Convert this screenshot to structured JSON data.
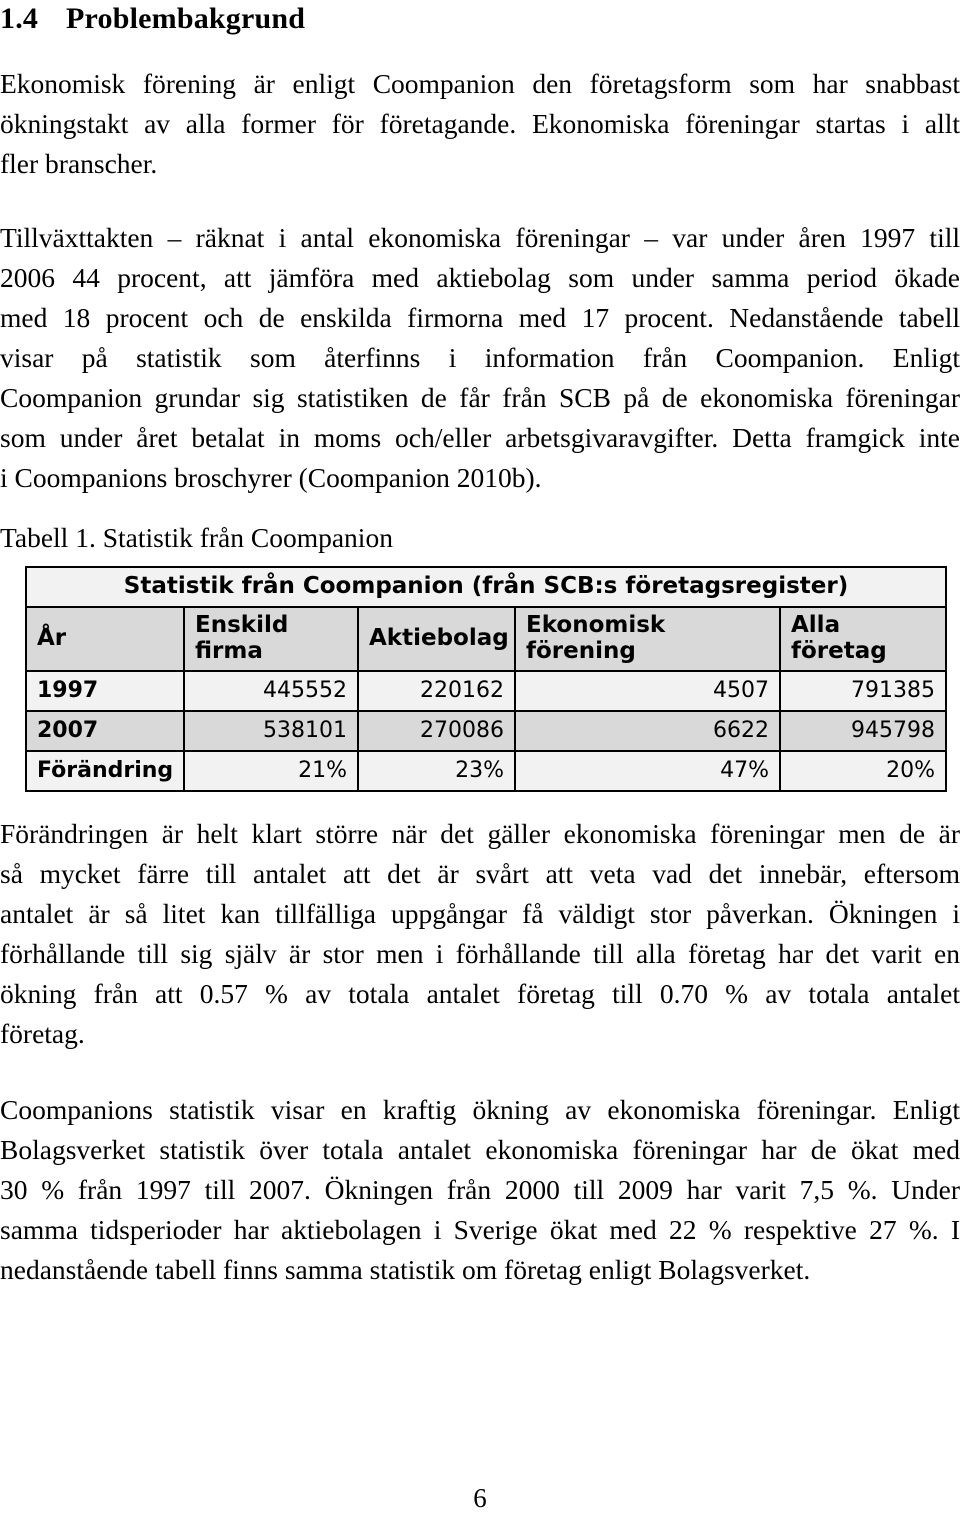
{
  "document": {
    "heading": {
      "number": "1.4",
      "title": "Problembakgrund"
    },
    "paragraphs": {
      "p1": {
        "lines": [
          "Ekonomisk förening är enligt Coompanion den företagsform som har snabbast",
          "ökningstakt av alla former för företagande. Ekonomiska föreningar startas i allt",
          "fler branscher."
        ]
      },
      "p2": {
        "lines": [
          "Tillväxttakten – räknat i antal ekonomiska föreningar – var under åren 1997 till",
          "2006 44 procent, att jämföra med aktiebolag som under samma period ökade",
          "med 18 procent och de enskilda firmorna med 17 procent. Nedanstående tabell",
          "visar på statistik som återfinns i information från Coompanion. Enligt",
          "Coompanion grundar sig statistiken de får från SCB på de ekonomiska föreningar",
          "som under året betalat in moms och/eller arbetsgivaravgifter. Detta framgick inte",
          "i Coompanions broschyrer (Coompanion 2010b)."
        ]
      },
      "p3": {
        "lines": [
          "Förändringen är helt klart större när det gäller ekonomiska föreningar men de är",
          "så mycket färre till antalet att det är svårt att veta vad det innebär, eftersom",
          "antalet är så litet kan tillfälliga uppgångar få väldigt stor påverkan. Ökningen i",
          "förhållande till sig själv är stor men i förhållande till alla företag har det varit en",
          "ökning från att 0.57 % av totala antalet företag till 0.70 % av totala antalet",
          "företag."
        ]
      },
      "p4": {
        "lines": [
          "Coompanions statistik visar en kraftig ökning av ekonomiska föreningar. Enligt",
          "Bolagsverket statistik över totala antalet ekonomiska föreningar har de ökat med",
          "30 % från 1997 till 2007. Ökningen från 2000 till 2009 har varit 7,5 %. Under",
          "samma tidsperioder har aktiebolagen i Sverige ökat med 22 % respektive 27 %. I",
          "nedanstående tabell finns samma statistik om företag enligt Bolagsverket."
        ]
      }
    },
    "table_caption": "Tabell 1. Statistik från Coompanion",
    "table": {
      "title": "Statistik från Coompanion (från SCB:s företagsregister)",
      "columns": [
        "År",
        "Enskild firma",
        "Aktiebolag",
        "Ekonomisk förening",
        "Alla företag"
      ],
      "rows": [
        {
          "label": "1997",
          "values": [
            "445552",
            "220162",
            "4507",
            "791385"
          ],
          "shaded": false
        },
        {
          "label": "2007",
          "values": [
            "538101",
            "270086",
            "6622",
            "945798"
          ],
          "shaded": true
        },
        {
          "label": "Förändring",
          "values": [
            "21%",
            "23%",
            "47%",
            "20%"
          ],
          "shaded": false
        }
      ]
    },
    "footer": {
      "page_number": "6"
    },
    "colors": {
      "text": "#000000",
      "page_background": "#ffffff",
      "table_border": "#000000",
      "table_title_fill": "#f2f2f2",
      "table_header_fill": "#d9d9d9",
      "table_row_shaded_fill": "#d9d9d9",
      "table_row_plain_fill": "#f2f2f2"
    }
  }
}
